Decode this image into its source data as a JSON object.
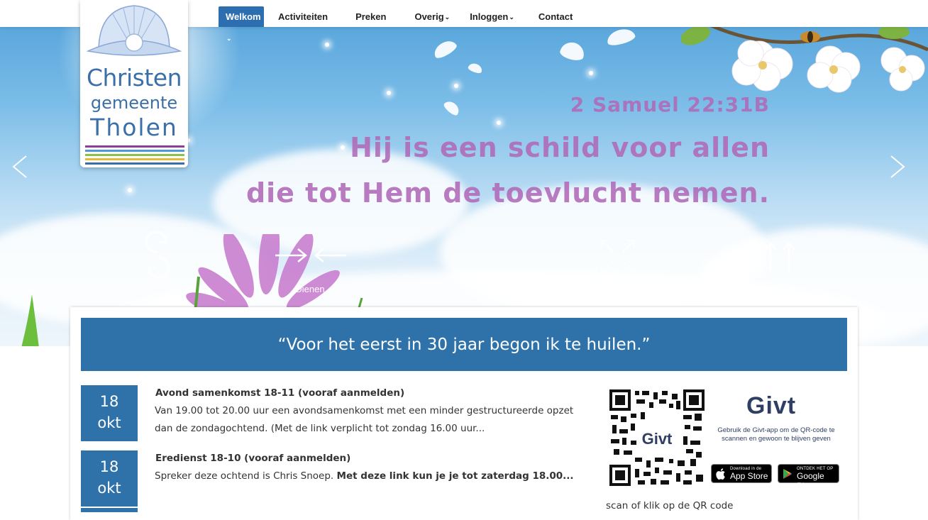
{
  "header": {
    "logo": {
      "line1": "Christen",
      "line2": "gemeente",
      "line3": "Tholen",
      "stripe_colors": [
        "#8e3e99",
        "#4d9ad4",
        "#89c24b",
        "#e9b83b",
        "#3b6fa8"
      ]
    },
    "nav": [
      {
        "label": "Welkom",
        "has_dropdown": true,
        "active": true
      },
      {
        "label": "Activiteiten",
        "has_dropdown": false,
        "active": false
      },
      {
        "label": "Preken",
        "has_dropdown": false,
        "active": false
      },
      {
        "label": "Overig",
        "has_dropdown": true,
        "active": false
      },
      {
        "label": "Inloggen",
        "has_dropdown": true,
        "active": false
      },
      {
        "label": "Contact",
        "has_dropdown": false,
        "active": false
      }
    ],
    "caret_glyph": "⌄"
  },
  "hero": {
    "reference": "2 Samuel 22:31B",
    "line1": "Hij is een schild voor allen",
    "line2": "die tot Hem de toevlucht nemen.",
    "prev_icon": "chevron-left-icon",
    "next_icon": "chevron-right-icon",
    "features": [
      {
        "icon": "cycle-icon",
        "label": ""
      },
      {
        "icon": "arrows-inward-icon",
        "label": "Dienen"
      },
      {
        "icon": "",
        "label": ""
      },
      {
        "icon": "expand-icon",
        "label": ""
      },
      {
        "icon": "three-arrows-up-icon",
        "label": ""
      }
    ]
  },
  "banner": {
    "quote": "“Voor het eerst in 30 jaar begon ik te huilen.”"
  },
  "events": [
    {
      "day": "18",
      "month": "okt",
      "title": "Avond samenkomst 18-11 (vooraf aanmelden)",
      "text": "Van 19.00 tot 20.00 uur een avondsamenkomst met een minder gestructureerde opzet dan de zondagochtend.  (Met de link verplicht tot zondag 16.00 uur..."
    },
    {
      "day": "18",
      "month": "okt",
      "title": "Eredienst 18-10 (vooraf aanmelden)",
      "text_plain": "Spreker deze ochtend is Chris Snoep. ",
      "text_bold": "Met deze link kun je je tot zaterdag 18.00..."
    }
  ],
  "givt": {
    "qr_label": "Givt",
    "logo": "Givt",
    "description": "Gebruik de Givt-app om de QR-code te scannen en gewoon te blijven geven",
    "app_store_small": "Download in de",
    "app_store": "App Store",
    "google_play_small": "ONTDEK HET OP",
    "google_play": "Google Play",
    "scan_text": "scan of klik op de QR code"
  },
  "colors": {
    "accent": "#2e72a9",
    "scripture": "#b06ab8",
    "logo_blue": "#3b6fa8",
    "givt_navy": "#2f3e63"
  }
}
